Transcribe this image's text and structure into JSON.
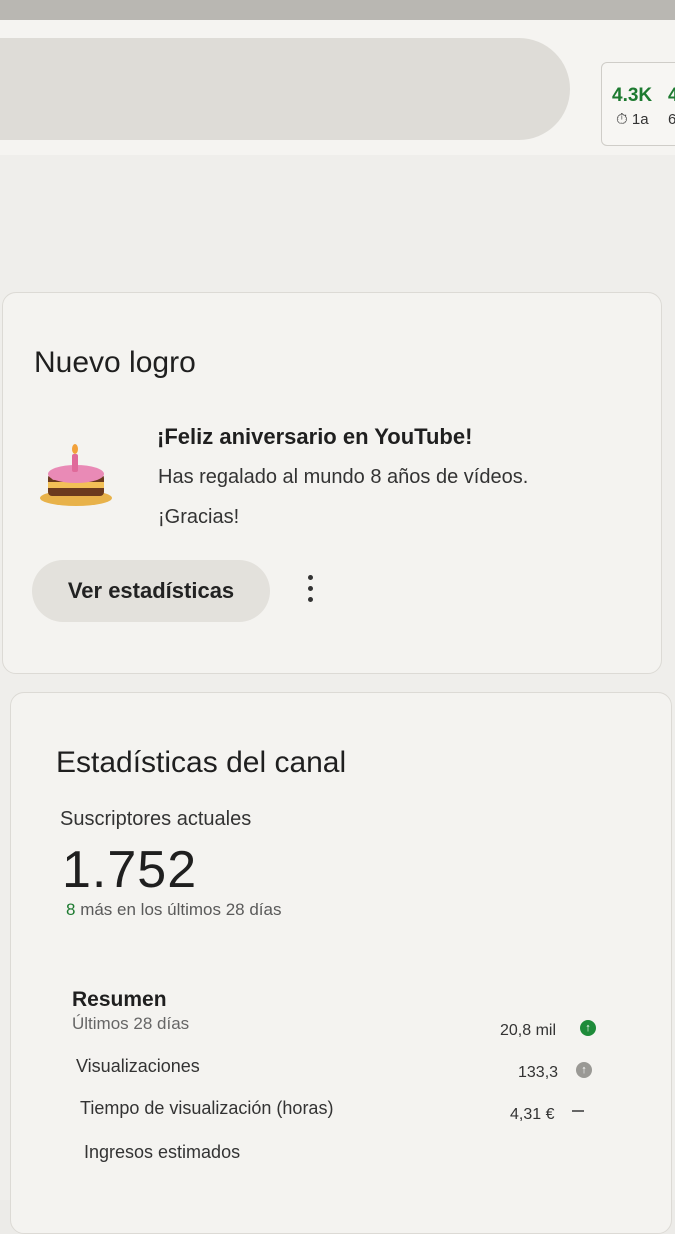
{
  "header": {
    "views_main": "4.3K",
    "views_partial": "4",
    "meta_main": "1a",
    "meta_partial": "6"
  },
  "achievement": {
    "card_title": "Nuevo logro",
    "headline": "¡Feliz aniversario en YouTube!",
    "description": "Has regalado al mundo 8 años de vídeos.",
    "thanks": "¡Gracias!",
    "button_label": "Ver estadísticas",
    "icon": "birthday-cake-icon"
  },
  "channel_stats": {
    "card_title": "Estadísticas del canal",
    "subscribers_label": "Suscriptores actuales",
    "subscribers_value": "1.752",
    "subscribers_delta_number": "8",
    "subscribers_delta_text": " más en los últimos 28 días",
    "summary": {
      "title": "Resumen",
      "period": "Últimos 28 días",
      "metrics": [
        {
          "label": "Visualizaciones",
          "value": "20,8 mil",
          "trend": "up"
        },
        {
          "label": "Tiempo de visualización (horas)",
          "value": "133,3",
          "trend": "neutral"
        },
        {
          "label": "Ingresos estimados",
          "value": "4,31 €",
          "trend": "none"
        }
      ]
    }
  },
  "colors": {
    "accent_green": "#1d7a30",
    "background": "#efeeeb"
  }
}
